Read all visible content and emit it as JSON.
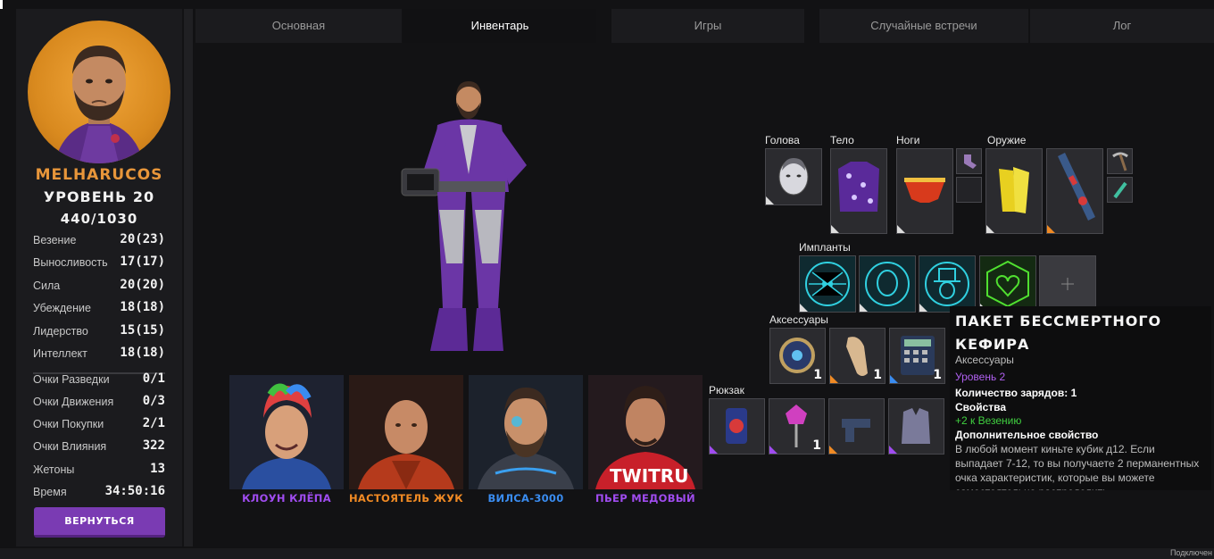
{
  "tabs": [
    "Основная",
    "Инвентарь",
    "Игры",
    "Случайные встречи",
    "Лог"
  ],
  "player": {
    "name": "MELHARUCOS",
    "level": "УРОВЕНЬ 20",
    "xp": "440/1030"
  },
  "stats": [
    {
      "label": "Везение",
      "value": "20(23)"
    },
    {
      "label": "Выносливость",
      "value": "17(17)"
    },
    {
      "label": "Сила",
      "value": "20(20)"
    },
    {
      "label": "Убеждение",
      "value": "18(18)"
    },
    {
      "label": "Лидерство",
      "value": "15(15)"
    },
    {
      "label": "Интеллект",
      "value": "18(18)"
    }
  ],
  "points": [
    {
      "label": "Очки Разведки",
      "value": "0/1"
    },
    {
      "label": "Очки Движения",
      "value": "0/3"
    },
    {
      "label": "Очки Покупки",
      "value": "2/1"
    },
    {
      "label": "Очки Влияния",
      "value": "322"
    },
    {
      "label": "Жетоны",
      "value": "13"
    },
    {
      "label": "Время",
      "value": "34:50:16"
    }
  ],
  "return_label": "ВЕРНУТЬСЯ",
  "companions": [
    {
      "name": "КЛОУН КЛЁПА",
      "color": "#a04cf0"
    },
    {
      "name": "НАСТОЯТЕЛЬ ЖУК",
      "color": "#f08a24"
    },
    {
      "name": "ВИЛСА-3000",
      "color": "#3a8cf0"
    },
    {
      "name": "ПЬЕР МЕДОВЫЙ",
      "color": "#a04cf0"
    }
  ],
  "slots": {
    "head": "Голова",
    "body": "Тело",
    "legs": "Ноги",
    "weapon": "Оружие",
    "implants": "Импланты",
    "accessories": "Аксессуары",
    "backpack": "Рюкзак"
  },
  "accessory_counts": [
    "1",
    "1",
    "1"
  ],
  "backpack_counts": [
    "",
    "1",
    "",
    ""
  ],
  "tooltip": {
    "title": "ПАКЕТ БЕССМЕРТНОГО КЕФИРА",
    "category": "Аксессуары",
    "level": "Уровень 2",
    "charges": "Количество зарядов: 1",
    "props_header": "Свойства",
    "prop": "+2 к Везению",
    "extra_header": "Дополнительное свойство",
    "description": "В любой момент киньте кубик д12. Если выпадает 7-12, то вы получаете 2 перманентных очка характеристик, которые вы можете самостоятельно распределить."
  },
  "status": "Подключен"
}
